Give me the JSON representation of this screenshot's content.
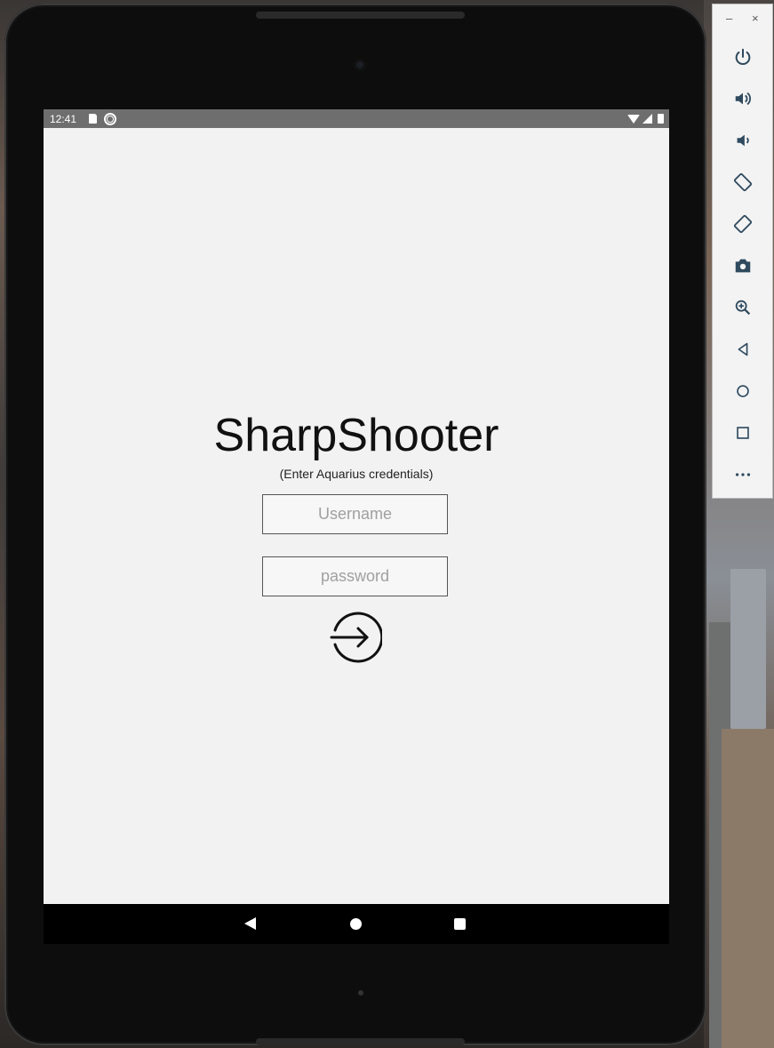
{
  "status_bar": {
    "time": "12:41",
    "icons": [
      "sd-card-icon",
      "sync-icon",
      "wifi-icon",
      "cell-signal-icon",
      "battery-icon"
    ]
  },
  "app": {
    "title": "SharpShooter",
    "subtitle": "(Enter Aquarius credentials)",
    "username_placeholder": "Username",
    "password_placeholder": "password",
    "login_icon": "login-arrow-icon"
  },
  "nav_bar": {
    "buttons": [
      "back-icon",
      "home-icon",
      "recents-icon"
    ]
  },
  "emulator_toolbar": {
    "window_controls": [
      "–",
      "×"
    ],
    "buttons": [
      "power-icon",
      "volume-up-icon",
      "volume-down-icon",
      "rotate-left-icon",
      "rotate-right-icon",
      "camera-icon",
      "zoom-icon",
      "back-icon",
      "home-icon",
      "overview-icon",
      "more-icon"
    ]
  },
  "colors": {
    "screen_bg": "#f2f2f2",
    "status_bar_bg": "#6e6e6e",
    "nav_bar_bg": "#000000",
    "toolbar_icon": "#2f4a5e"
  }
}
